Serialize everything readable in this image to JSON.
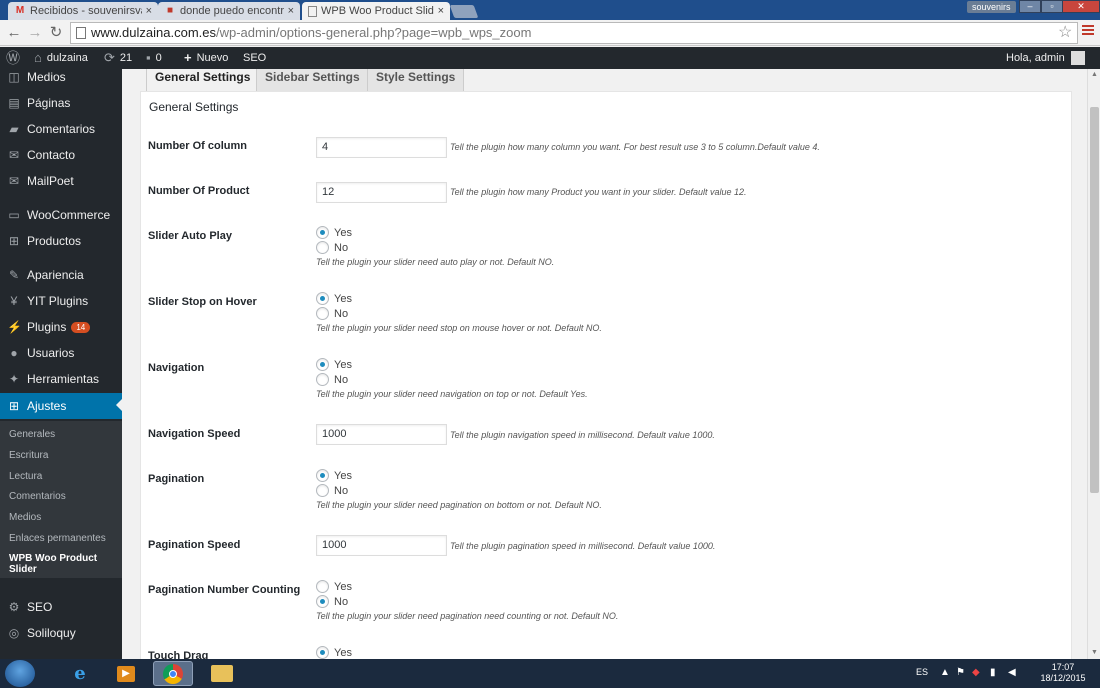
{
  "browser": {
    "tabs": [
      {
        "title": "Recibidos - souvenirsvaler",
        "icon": "gmail-icon",
        "close": "×"
      },
      {
        "title": "donde puedo encontrar p",
        "icon": "web-icon",
        "close": "×"
      },
      {
        "title": "WPB Woo Product Slider",
        "icon": "page-icon",
        "close": "×"
      }
    ],
    "profile_name": "souvenirs",
    "url_host": "www.dulzaina.com.es",
    "url_path": "/wp-admin/options-general.php?page=wpb_wps_zoom"
  },
  "adminbar": {
    "site_name": "dulzaina",
    "updates_count": "21",
    "comments_count": "0",
    "new_label": "Nuevo",
    "seo_label": "SEO",
    "greeting": "Hola, admin"
  },
  "sidebar": {
    "items": [
      {
        "label": "Medios",
        "icon": "media-icon"
      },
      {
        "label": "Páginas",
        "icon": "pages-icon"
      },
      {
        "label": "Comentarios",
        "icon": "comments-icon"
      },
      {
        "label": "Contacto",
        "icon": "mail-icon"
      },
      {
        "label": "MailPoet",
        "icon": "mailpoet-icon"
      },
      {
        "label": "WooCommerce",
        "icon": "woocommerce-icon"
      },
      {
        "label": "Productos",
        "icon": "cart-icon"
      },
      {
        "label": "Apariencia",
        "icon": "brush-icon"
      },
      {
        "label": "YIT Plugins",
        "icon": "yit-icon"
      },
      {
        "label": "Plugins",
        "icon": "plugin-icon",
        "badge": "14"
      },
      {
        "label": "Usuarios",
        "icon": "user-icon"
      },
      {
        "label": "Herramientas",
        "icon": "wrench-icon"
      },
      {
        "label": "Ajustes",
        "icon": "settings-icon"
      }
    ],
    "submenu": [
      "Generales",
      "Escritura",
      "Lectura",
      "Comentarios",
      "Medios",
      "Enlaces permanentes",
      "WPB Woo Product Slider"
    ],
    "bottom_items": [
      {
        "label": "SEO",
        "icon": "seo-icon"
      },
      {
        "label": "Soliloquy",
        "icon": "soliloquy-icon"
      }
    ]
  },
  "tabs": [
    "General Settings",
    "Sidebar Settings",
    "Style Settings"
  ],
  "panel_title": "General Settings",
  "fields": {
    "columns": {
      "label": "Number Of column",
      "value": "4",
      "desc": "Tell the plugin how many column you want. For best result use 3 to 5 column.Default value 4."
    },
    "products": {
      "label": "Number Of Product",
      "value": "12",
      "desc": "Tell the plugin how many Product you want in your slider. Default value 12."
    },
    "autoplay": {
      "label": "Slider Auto Play",
      "yes": "Yes",
      "no": "No",
      "selected": "Yes",
      "desc": "Tell the plugin your slider need auto play or not. Default NO."
    },
    "stop_hover": {
      "label": "Slider Stop on Hover",
      "yes": "Yes",
      "no": "No",
      "selected": "Yes",
      "desc": "Tell the plugin your slider need stop on mouse hover or not. Default NO."
    },
    "navigation": {
      "label": "Navigation",
      "yes": "Yes",
      "no": "No",
      "selected": "Yes",
      "desc": "Tell the plugin your slider need navigation on top or not. Default Yes."
    },
    "nav_speed": {
      "label": "Navigation Speed",
      "value": "1000",
      "desc": "Tell the plugin navigation speed in millisecond. Default value 1000."
    },
    "pagination": {
      "label": "Pagination",
      "yes": "Yes",
      "no": "No",
      "selected": "Yes",
      "desc": "Tell the plugin your slider need pagination on bottom or not. Default NO."
    },
    "pag_speed": {
      "label": "Pagination Speed",
      "value": "1000",
      "desc": "Tell the plugin pagination speed in millisecond. Default value 1000."
    },
    "pag_counting": {
      "label": "Pagination Number Counting",
      "yes": "Yes",
      "no": "No",
      "selected": "No",
      "desc": "Tell the plugin your slider need pagination need counting or not. Default NO."
    },
    "touch_drag": {
      "label": "Touch Drag",
      "yes": "Yes",
      "selected": "Yes"
    }
  },
  "taskbar": {
    "language": "ES",
    "time": "17:07",
    "date": "18/12/2015"
  },
  "colors": {
    "wp_blue": "#0073aa",
    "admin_dark": "#23282d",
    "radio_dot": "#1e8cbe"
  }
}
